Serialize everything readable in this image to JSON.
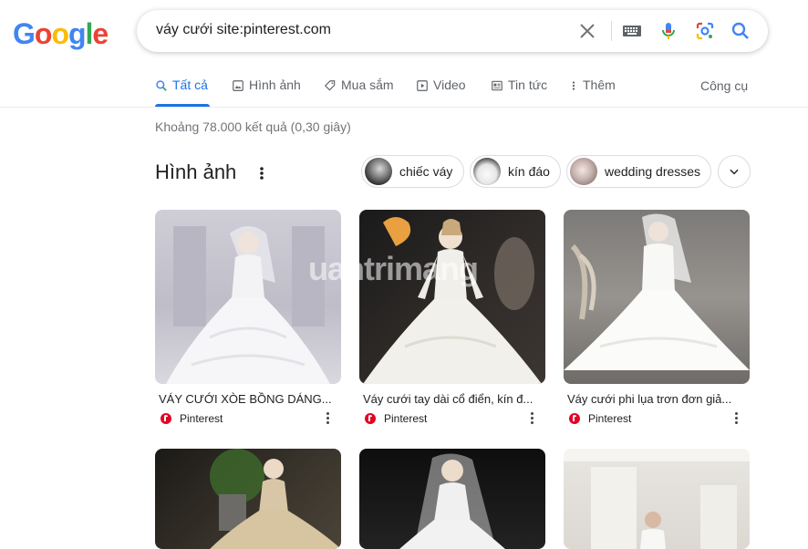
{
  "logo": {
    "letters": [
      "G",
      "o",
      "o",
      "g",
      "l",
      "e"
    ],
    "colors": [
      "#4285F4",
      "#EA4335",
      "#FBBC05",
      "#4285F4",
      "#34A853",
      "#EA4335"
    ]
  },
  "search": {
    "query": "váy cưới site:pinterest.com"
  },
  "tabs": [
    {
      "label": "Tất cả",
      "icon": "search-icon",
      "active": true
    },
    {
      "label": "Hình ảnh",
      "icon": "image-icon"
    },
    {
      "label": "Mua sắm",
      "icon": "tag-icon"
    },
    {
      "label": "Video",
      "icon": "play-icon"
    },
    {
      "label": "Tin tức",
      "icon": "news-icon"
    },
    {
      "label": "Thêm",
      "icon": "more-vert-icon"
    }
  ],
  "tools_label": "Công cụ",
  "result_stats": "Khoảng 78.000 kết quả (0,30 giây)",
  "images_section": {
    "heading": "Hình ảnh",
    "chips": [
      "chiếc váy",
      "kín đáo",
      "wedding dresses"
    ]
  },
  "results": [
    {
      "caption": "VÁY CƯỚI XÒE BỒNG DÁNG...",
      "source": "Pinterest"
    },
    {
      "caption": "Váy cưới tay dài cổ điển, kín đ...",
      "source": "Pinterest"
    },
    {
      "caption": "Váy cưới phi lụa trơn đơn giả...",
      "source": "Pinterest"
    }
  ],
  "watermark": "uantrimang",
  "colors": {
    "accent": "#1a73e8",
    "pinterest": "#e60023"
  }
}
